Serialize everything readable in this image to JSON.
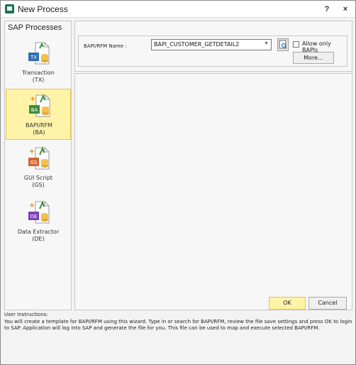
{
  "window": {
    "title": "New Process",
    "help_label": "?",
    "close_label": "×"
  },
  "sidebar": {
    "title": "SAP Processes",
    "items": [
      {
        "name": "Transaction",
        "code": "(TX)",
        "badge": "TX",
        "badge_color": "#2f6db5"
      },
      {
        "name": "BAPI/RFM",
        "code": "(BA)",
        "badge": "BA",
        "badge_color": "#3e8e3a",
        "selected": true
      },
      {
        "name": "GUI Script",
        "code": "(GS)",
        "badge": "GS",
        "badge_color": "#d2672a"
      },
      {
        "name": "Data Extractor",
        "code": "(DE)",
        "badge": "DE",
        "badge_color": "#7b3fb4"
      }
    ]
  },
  "form": {
    "bapi_label": "BAPI/RFM Name :",
    "bapi_value": "BAPI_CUSTOMER_GETDETAIL2",
    "allow_only_bapis_label": "Allow only BAPIs",
    "more_label": "More..."
  },
  "buttons": {
    "ok_label": "OK",
    "cancel_label": "Cancel"
  },
  "instructions": {
    "heading": "User Instructions:",
    "text": "You will create a template for BAPI/RFM using this wizard. Type in or search for BAPI/RFM, review the file save settings and press OK to login to SAP. Application will log into SAP and generate the file for you. This file can be used to map and execute selected BAPI/RFM."
  },
  "colors": {
    "selected_bg": "#fff3a8",
    "accent": "#1f6f55"
  }
}
